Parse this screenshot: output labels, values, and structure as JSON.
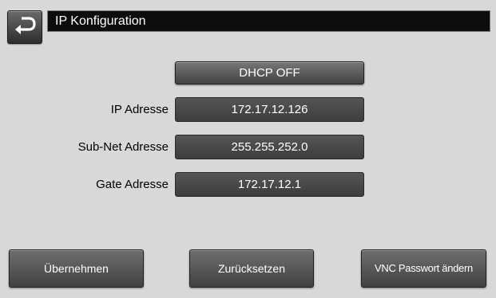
{
  "header": {
    "title": "IP Konfiguration",
    "back_icon": "return-arrow-icon"
  },
  "dhcp": {
    "label": "DHCP OFF"
  },
  "fields": [
    {
      "label": "IP Adresse",
      "value": "172.17.12.126"
    },
    {
      "label": "Sub-Net Adresse",
      "value": "255.255.252.0"
    },
    {
      "label": "Gate Adresse",
      "value": "172.17.12.1"
    }
  ],
  "buttons": {
    "apply": "Übernehmen",
    "reset": "Zurücksetzen",
    "vnc_password": "VNC Passwort ändern"
  },
  "colors": {
    "background": "#d8d8d8",
    "title_bar": "#0d0d0d",
    "button": "#555555",
    "text_light": "#ffffff"
  }
}
